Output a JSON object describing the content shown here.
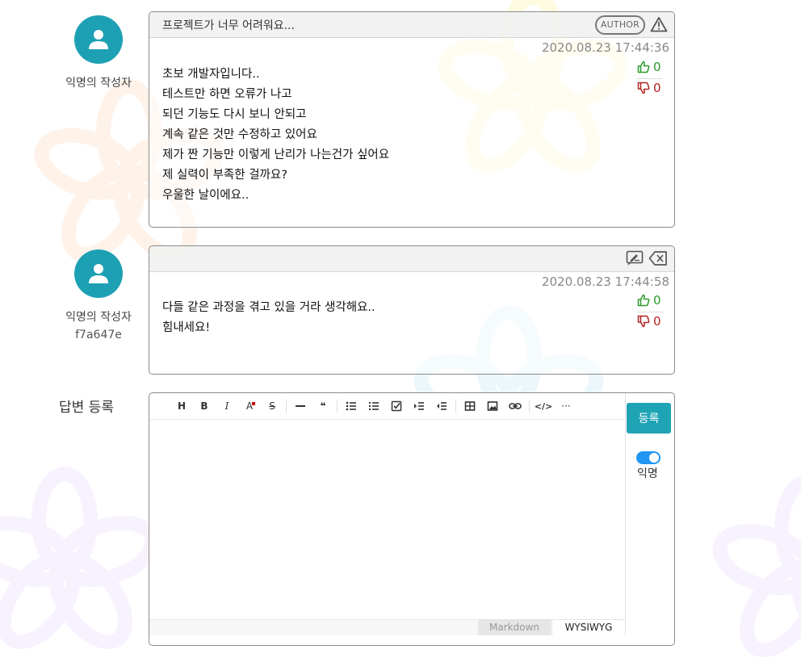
{
  "colors": {
    "accent": "#1fa4b5",
    "toggle": "#2196f3",
    "upvote": "#2a9a2a",
    "downvote": "#b22222"
  },
  "posts": [
    {
      "author": "익명의 작성자",
      "title": "프로젝트가 너무 어려워요...",
      "badge": "AUTHOR",
      "timestamp": "2020.08.23 17:44:36",
      "upvotes": "0",
      "downvotes": "0",
      "lines": [
        "초보 개발자입니다..",
        "테스트만 하면 오류가 나고",
        "되던 기능도 다시 보니 안되고",
        "계속 같은 것만 수정하고 있어요",
        "제가 짠 기능만 이렇게 난리가 나는건가 싶어요",
        "제 실력이 부족한 걸까요?",
        "우울한 날이에요.."
      ]
    },
    {
      "author": "익명의 작성자",
      "author_hash": "f7a647e",
      "timestamp": "2020.08.23 17:44:58",
      "upvotes": "0",
      "downvotes": "0",
      "lines": [
        "다들 같은 과정을 겪고 있을 거라 생각해요..",
        "힘내세요!"
      ]
    }
  ],
  "reply": {
    "label": "답변 등록",
    "submit_label": "등록",
    "anonymous_label": "익명",
    "anonymous_on": true,
    "mode_markdown": "Markdown",
    "mode_wysiwyg": "WYSIWYG",
    "toolbar": {
      "heading": "H",
      "bold": "B",
      "italic": "I",
      "color": "A",
      "strike": "S",
      "quote": "❝",
      "code": "</>",
      "more": "···"
    }
  }
}
